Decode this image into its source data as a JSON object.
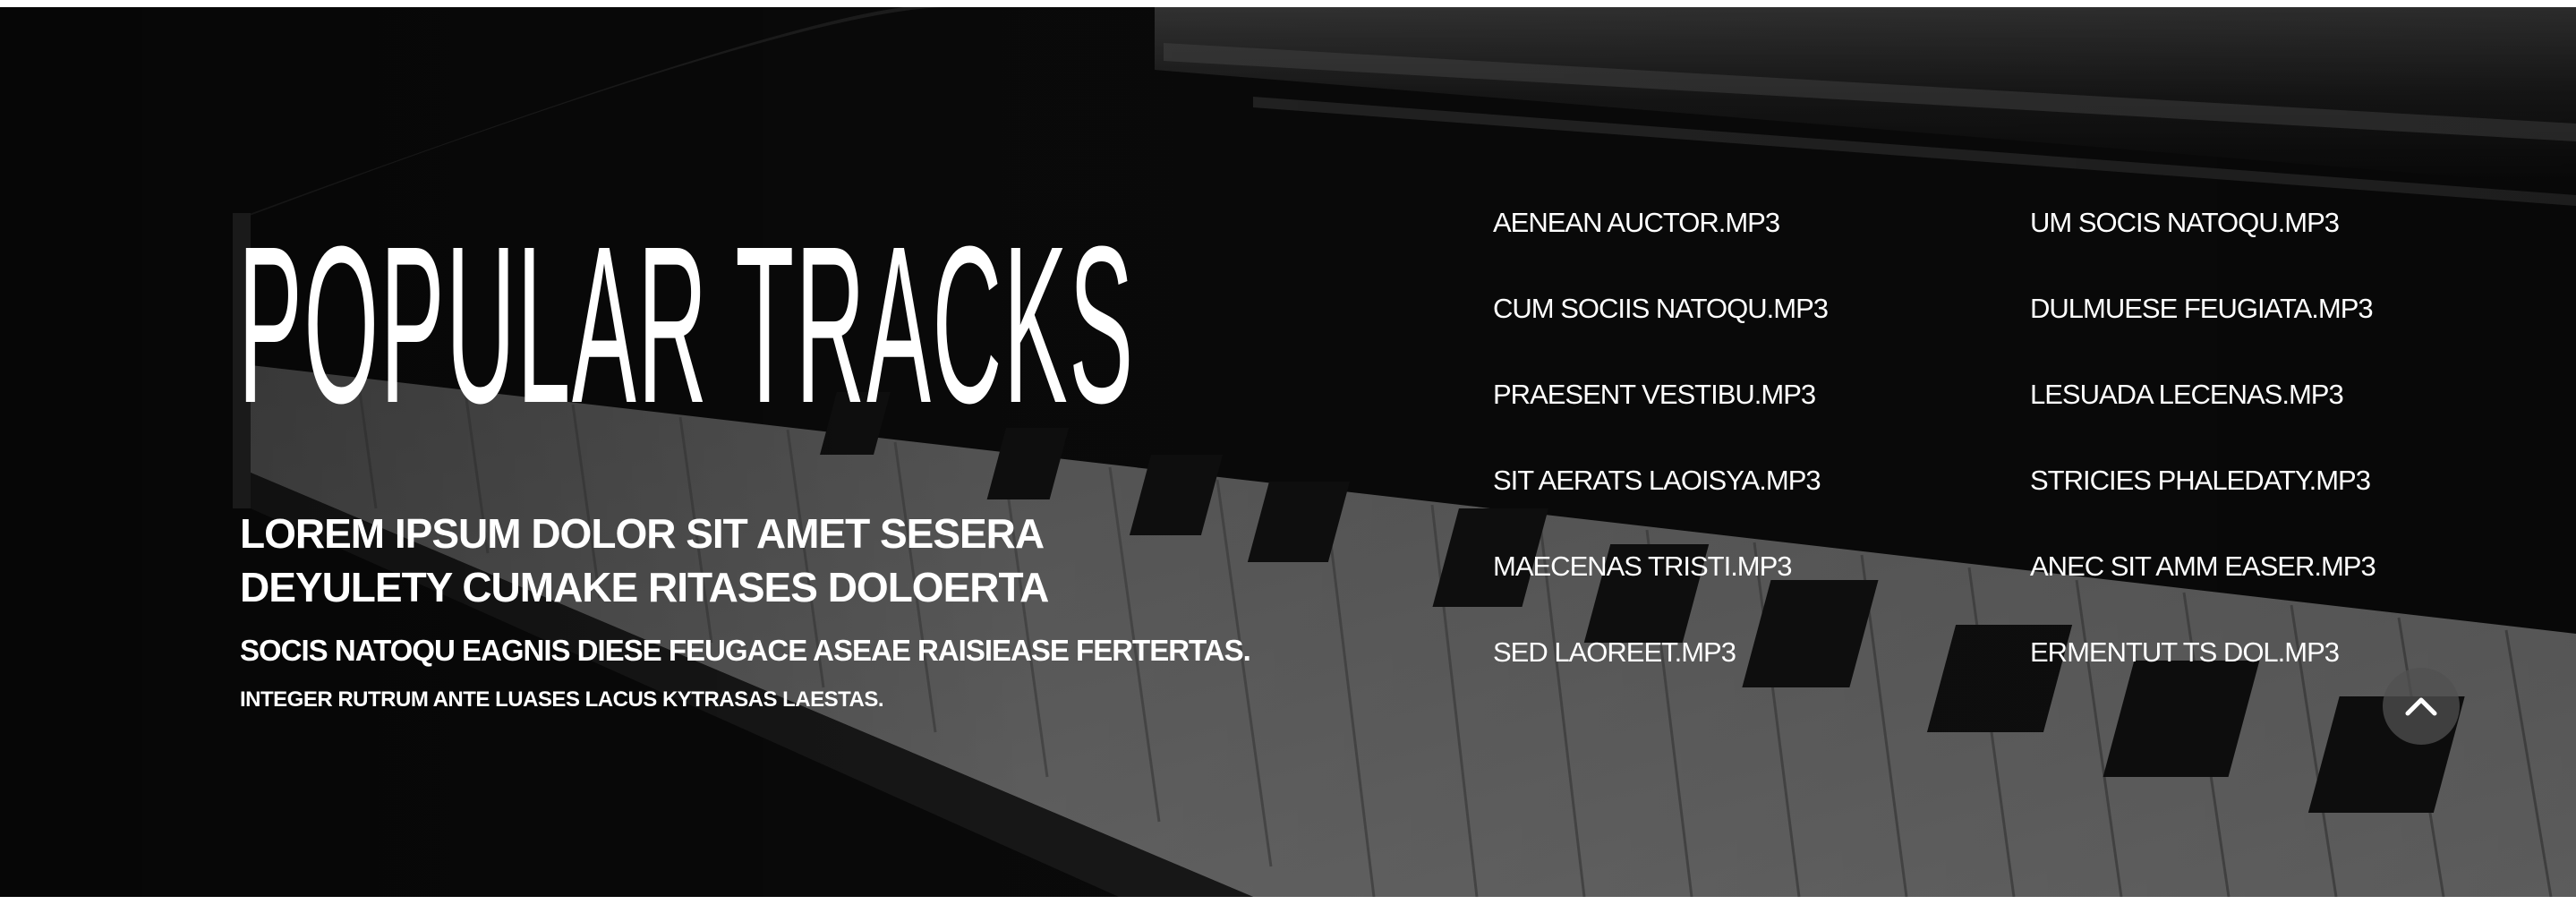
{
  "section": {
    "title": "POPULAR TRACKS",
    "lead": "LOREM IPSUM DOLOR SIT AMET SESERA DEYULETY CUMAKE RITASES DOLOERTA",
    "sub1": "SOCIS NATOQU EAGNIS DIESE FEUGACE ASEAE RAISIEASE FERTERTAS.",
    "sub2": "INTEGER RUTRUM ANTE LUASES LACUS KYTRASAS LAESTAS."
  },
  "tracks": [
    "AENEAN AUCTOR.MP3",
    "UM SOCIS NATOQU.MP3",
    "CUM SOCIIS NATOQU.MP3",
    "DULMUESE FEUGIATA.MP3",
    "PRAESENT VESTIBU.MP3",
    "LESUADA LECENAS.MP3",
    "SIT AERATS LAOISYA.MP3",
    "STRICIES PHALEDATY.MP3",
    "MAECENAS TRISTI.MP3",
    "ANEC SIT AMM EASER.MP3",
    "SED LAOREET.MP3",
    "ERMENTUT TS DOL.MP3"
  ],
  "scroll_top": {
    "icon": "chevron-up-icon"
  },
  "colors": {
    "background": "#0d0d0d",
    "text": "#ffffff",
    "button": "#505050"
  }
}
